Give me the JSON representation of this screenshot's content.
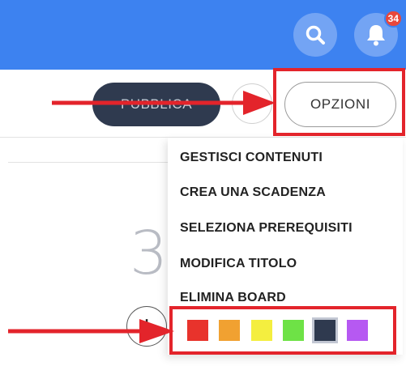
{
  "colors": {
    "primary": "#3d82f0",
    "accent_red": "#e3242b"
  },
  "header": {
    "search_icon": "search-icon",
    "bell_icon": "bell-icon",
    "notification_count": "34"
  },
  "toolbar": {
    "publish_label": "PUBBLICA",
    "options_label": "OPZIONI"
  },
  "board": {
    "counter": "3"
  },
  "menu": {
    "items": [
      {
        "label": "GESTISCI CONTENUTI"
      },
      {
        "label": "CREA UNA SCADENZA"
      },
      {
        "label": "SELEZIONA PREREQUISITI"
      },
      {
        "label": "MODIFICA TITOLO"
      },
      {
        "label": "ELIMINA BOARD"
      }
    ],
    "swatches": [
      {
        "color": "#e8332c",
        "selected": false
      },
      {
        "color": "#f1a131",
        "selected": false
      },
      {
        "color": "#f4ee3f",
        "selected": false
      },
      {
        "color": "#6ee246",
        "selected": false
      },
      {
        "color": "#2f3a4f",
        "selected": true
      },
      {
        "color": "#b659f2",
        "selected": false
      }
    ]
  }
}
